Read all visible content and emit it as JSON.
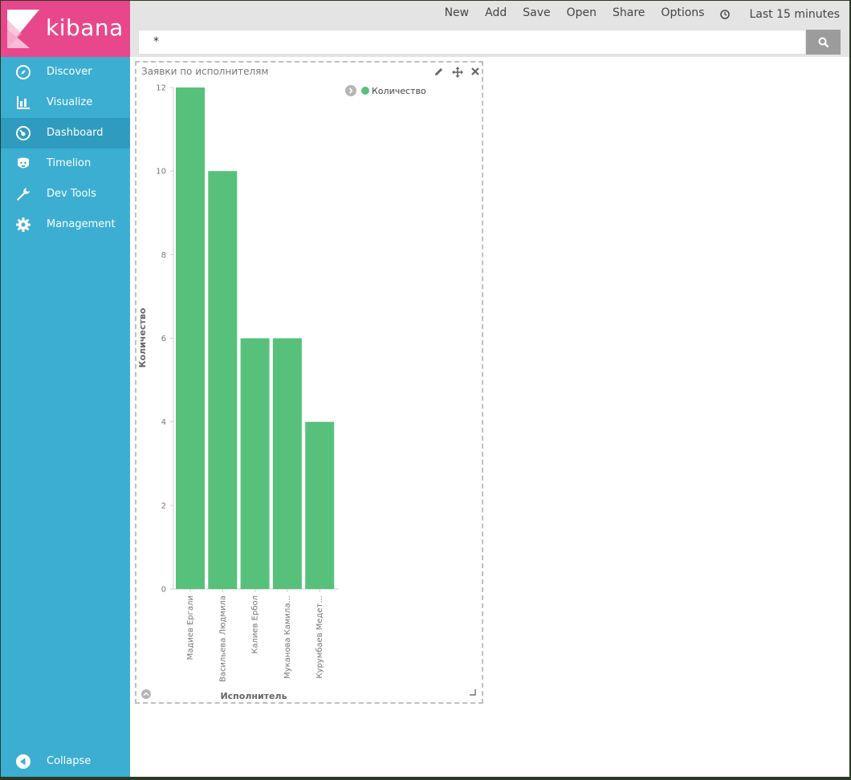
{
  "app": {
    "logo_text": "kibana"
  },
  "sidebar": {
    "items": [
      {
        "label": "Discover",
        "icon": "compass-icon"
      },
      {
        "label": "Visualize",
        "icon": "bar-chart-icon"
      },
      {
        "label": "Dashboard",
        "icon": "dashboard-icon",
        "active": true
      },
      {
        "label": "Timelion",
        "icon": "timelion-icon"
      },
      {
        "label": "Dev Tools",
        "icon": "wrench-icon"
      },
      {
        "label": "Management",
        "icon": "gear-icon"
      }
    ],
    "collapse_label": "Collapse"
  },
  "topbar": {
    "menu": [
      "New",
      "Add",
      "Save",
      "Open",
      "Share",
      "Options"
    ],
    "time_label": "Last 15 minutes",
    "query_value": "*"
  },
  "panel": {
    "title": "Заявки по исполнителям"
  },
  "colors": {
    "bar": "#57c17b",
    "sidebar": "#3caed2",
    "logo": "#e8488b"
  },
  "chart_data": {
    "type": "bar",
    "categories": [
      "Мадиев Ергали",
      "Васильева Людмила",
      "Калиев Ербол",
      "Муканова Камила...",
      "Курумбаев Медет..."
    ],
    "series": [
      {
        "name": "Количество",
        "values": [
          12,
          10,
          6,
          6,
          4
        ]
      }
    ],
    "xlabel": "Исполнитель",
    "ylabel": "Количество",
    "ylim": [
      0,
      12
    ],
    "yticks": [
      0,
      2,
      4,
      6,
      8,
      10,
      12
    ],
    "legend": "top-right",
    "grid": false
  }
}
